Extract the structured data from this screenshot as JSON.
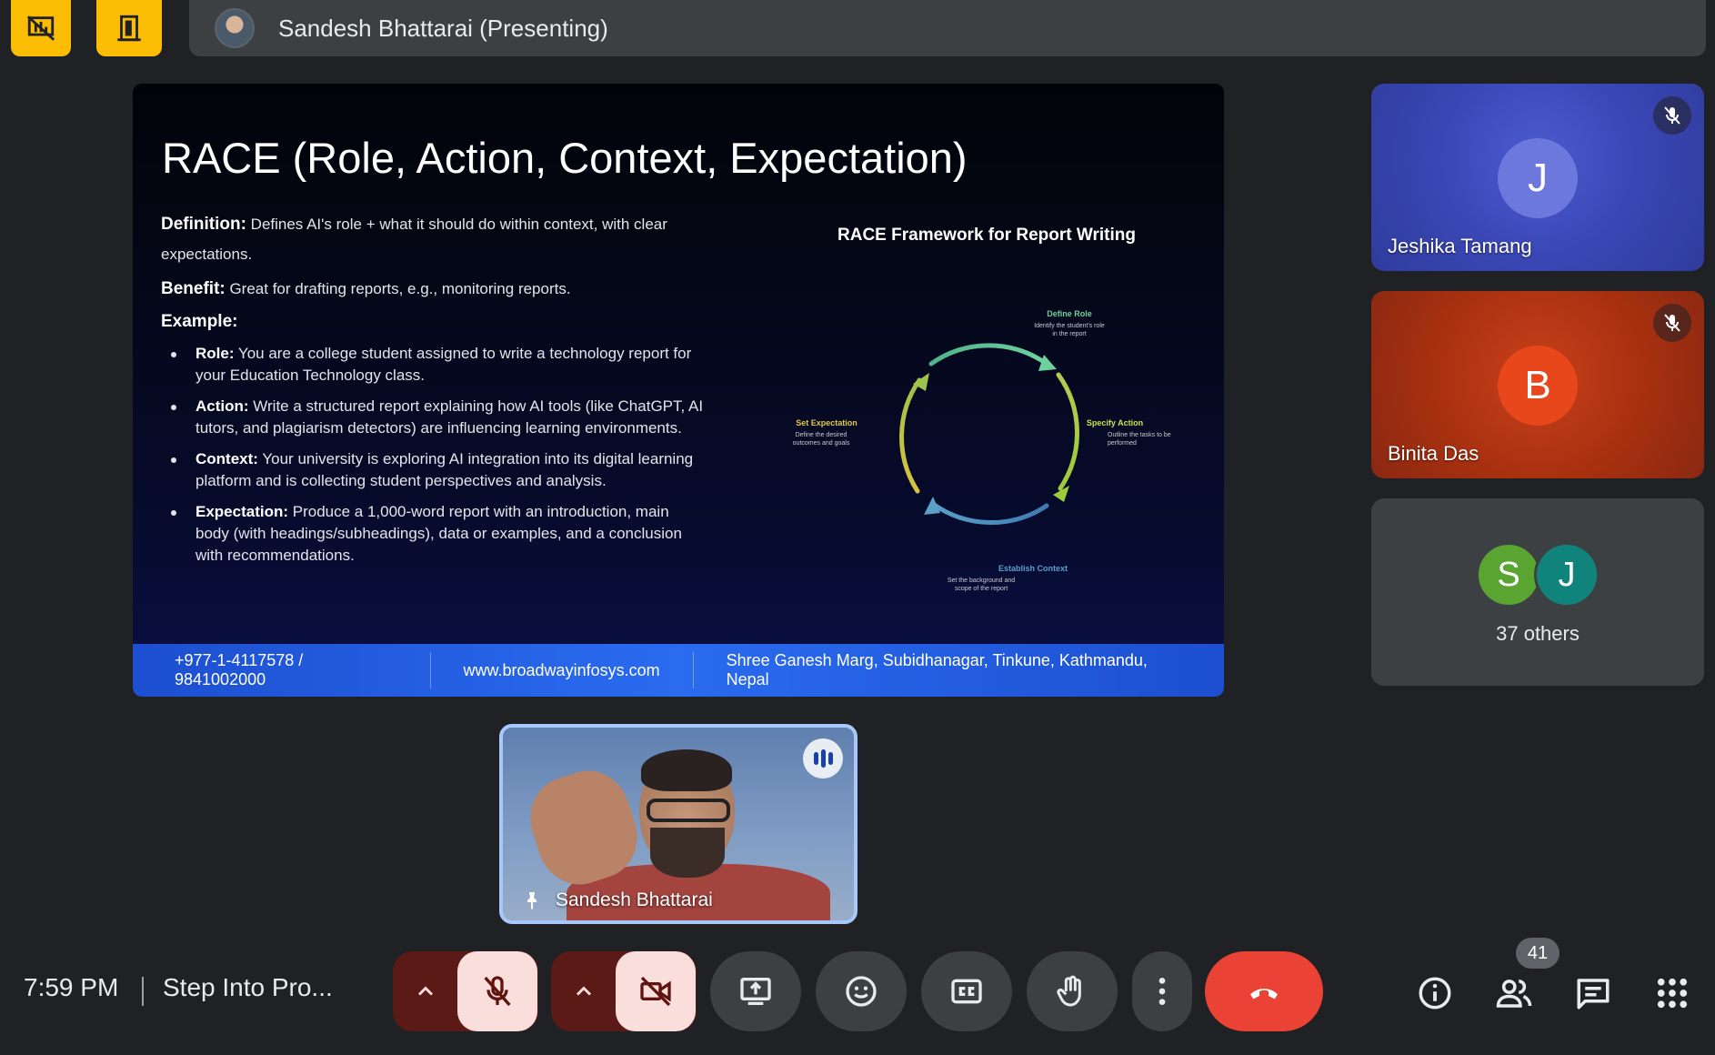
{
  "presenter_bar": {
    "name": "Sandesh Bhattarai (Presenting)"
  },
  "slide": {
    "title": "RACE (Role, Action, Context, Expectation)",
    "definition_label": "Definition:",
    "definition_text": " Defines AI's role + what it should do within context, with clear expectations.",
    "benefit_label": "Benefit:",
    "benefit_text": " Great for drafting reports, e.g., monitoring reports.",
    "example_label": "Example:",
    "bullets": [
      {
        "label": "Role:",
        "text": " You are a college student assigned to write a technology report for your Education Technology class."
      },
      {
        "label": "Action:",
        "text": " Write a structured report explaining how AI tools (like ChatGPT, AI tutors, and plagiarism detectors) are influencing learning environments."
      },
      {
        "label": "Context:",
        "text": " Your university is exploring AI integration into its digital learning platform and is collecting student perspectives and analysis."
      },
      {
        "label": "Expectation:",
        "text": " Produce a 1,000-word report with an introduction, main body (with headings/subheadings), data or examples, and a conclusion with recommendations."
      }
    ],
    "framework": {
      "title": "RACE Framework for Report Writing",
      "define_role": "Define Role",
      "define_role_desc": "Identify the student's role in the report",
      "specify_action": "Specify Action",
      "specify_action_desc": "Outline the tasks to be performed",
      "establish_context": "Establish Context",
      "establish_context_desc": "Set the background and scope of the report",
      "set_expectation": "Set Expectation",
      "set_expectation_desc": "Define the desired outcomes and goals"
    },
    "footer": {
      "phone": "+977-1-4117578 / 9841002000",
      "website": "www.broadwayinfosys.com",
      "address": "Shree Ganesh Marg, Subidhanagar, Tinkune, Kathmandu, Nepal"
    }
  },
  "participants": [
    {
      "initial": "J",
      "name": "Jeshika Tamang",
      "muted": true
    },
    {
      "initial": "B",
      "name": "Binita Das",
      "muted": true
    }
  ],
  "others": {
    "initial_1": "S",
    "initial_2": "J",
    "label": "37 others"
  },
  "self_tile": {
    "name": "Sandesh Bhattarai"
  },
  "bottom_bar": {
    "time": "7:59 PM",
    "meeting_title": "Step Into Pro...",
    "people_count": "41"
  },
  "icons": {
    "top_left_1": "presentation-off-icon",
    "top_left_2": "door-exit-icon",
    "mic": "mic-off-icon",
    "camera": "videocam-off-icon",
    "present": "present-screen-icon",
    "emoji": "emoji-icon",
    "captions": "captions-icon",
    "hand": "raise-hand-icon",
    "more": "more-vert-icon",
    "hangup": "call-end-icon",
    "info": "info-icon",
    "people": "people-icon",
    "chat": "chat-icon",
    "apps": "apps-grid-icon"
  },
  "colors": {
    "background": "#202124",
    "accent_yellow": "#fbbc04",
    "hangup_red": "#ea4335",
    "muted_control_bg": "#f9dedc",
    "slide_footer_blue": "#2a6bf0"
  }
}
